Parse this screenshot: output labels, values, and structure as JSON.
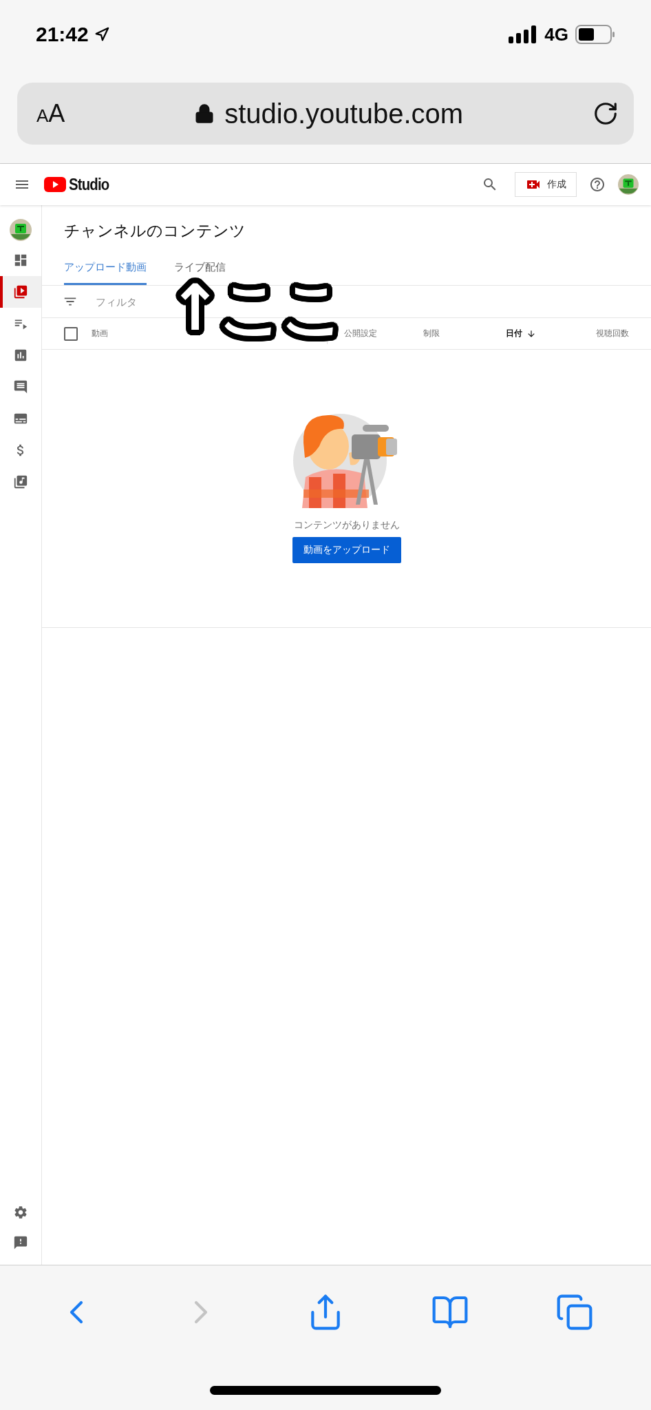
{
  "status_bar": {
    "time": "21:42",
    "network": "4G"
  },
  "browser": {
    "text_size_button": "AA",
    "url": "studio.youtube.com"
  },
  "header": {
    "logo_text": "Studio",
    "create_button": "作成"
  },
  "sidebar": {
    "items": [
      {
        "kind": "avatar",
        "selected": false
      },
      {
        "kind": "dashboard",
        "selected": false
      },
      {
        "kind": "content",
        "selected": true
      },
      {
        "kind": "playlists",
        "selected": false
      },
      {
        "kind": "analytics",
        "selected": false
      },
      {
        "kind": "comments",
        "selected": false
      },
      {
        "kind": "subtitles",
        "selected": false
      },
      {
        "kind": "monetization",
        "selected": false
      },
      {
        "kind": "audio",
        "selected": false
      }
    ],
    "bottom_items": [
      {
        "kind": "settings"
      },
      {
        "kind": "feedback"
      }
    ]
  },
  "page_title": "チャンネルのコンテンツ",
  "tabs": [
    {
      "label": "アップロード動画",
      "selected": true
    },
    {
      "label": "ライブ配信",
      "selected": false
    }
  ],
  "filter": {
    "placeholder": "フィルタ"
  },
  "table": {
    "select_all_checked": false,
    "columns": [
      {
        "label": "動画",
        "sorted": false
      },
      {
        "label": "公開設定",
        "sorted": false
      },
      {
        "label": "制限",
        "sorted": false
      },
      {
        "label": "日付",
        "sorted": true
      },
      {
        "label": "視聴回数",
        "sorted": false
      }
    ]
  },
  "empty_state": {
    "message": "コンテンツがありません",
    "upload_button": "動画をアップロード"
  },
  "annotation": {
    "text": "↑ここ"
  },
  "toolbar": [
    {
      "kind": "back",
      "disabled": false
    },
    {
      "kind": "forward",
      "disabled": true
    },
    {
      "kind": "share",
      "disabled": false
    },
    {
      "kind": "bookmarks",
      "disabled": false
    },
    {
      "kind": "tabs",
      "disabled": false
    }
  ]
}
